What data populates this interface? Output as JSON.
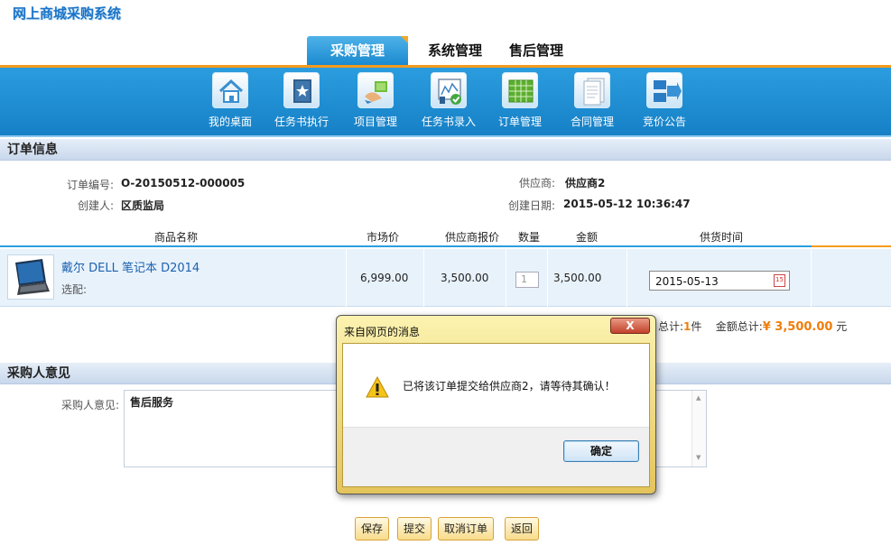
{
  "app": {
    "title": "网上商城采购系统"
  },
  "top_tabs": [
    {
      "label": "采购管理",
      "active": true
    },
    {
      "label": "系统管理",
      "active": false
    },
    {
      "label": "售后管理",
      "active": false
    }
  ],
  "nav": [
    {
      "label": "我的桌面",
      "icon": "home-icon"
    },
    {
      "label": "任务书执行",
      "icon": "book-icon"
    },
    {
      "label": "项目管理",
      "icon": "project-icon"
    },
    {
      "label": "任务书录入",
      "icon": "task-entry-icon"
    },
    {
      "label": "订单管理",
      "icon": "spreadsheet-icon"
    },
    {
      "label": "合同管理",
      "icon": "document-icon"
    },
    {
      "label": "竞价公告",
      "icon": "announcement-icon"
    }
  ],
  "order_info": {
    "section_title": "订单信息",
    "order_no_label": "订单编号:",
    "order_no": "O-20150512-000005",
    "creator_label": "创建人:",
    "creator": "区质监局",
    "supplier_label": "供应商:",
    "supplier": "供应商2",
    "created_label": "创建日期:",
    "created": "2015-05-12 10:36:47"
  },
  "table": {
    "headers": [
      "商品名称",
      "市场价",
      "供应商报价",
      "数量",
      "金额",
      "供货时间"
    ],
    "rows": [
      {
        "name": "戴尔 DELL 笔记本 D2014",
        "options_label": "选配:",
        "market_price": "6,999.00",
        "quote": "3,500.00",
        "qty": "1",
        "amount": "3,500.00",
        "delivery": "2015-05-13"
      }
    ]
  },
  "totals": {
    "count_label": "总计:",
    "count": "1",
    "count_unit": "件",
    "amount_label": "金额总计:",
    "amount": "¥ 3,500.00",
    "amount_unit": "元"
  },
  "opinion": {
    "section_title": "采购人意见",
    "label": "采购人意见:",
    "value": "售后服务"
  },
  "buttons": {
    "save": "保存",
    "submit": "提交",
    "cancel_order": "取消订单",
    "back": "返回"
  },
  "dialog": {
    "title": "来自网页的消息",
    "close_label": "X",
    "message": "已将该订单提交给供应商2，请等待其确认！",
    "ok_label": "确定"
  },
  "colors": {
    "accent_blue": "#1b8ad0",
    "accent_orange": "#f59b1c",
    "total_orange": "#f07d0a"
  }
}
